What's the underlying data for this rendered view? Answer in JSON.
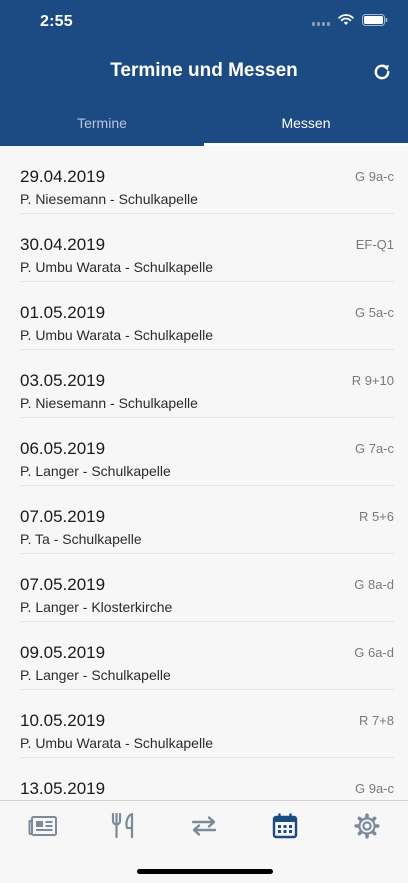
{
  "status_bar": {
    "time": "2:55"
  },
  "header": {
    "title": "Termine und Messen",
    "refresh_icon": "refresh-icon"
  },
  "tabs": [
    {
      "label": "Termine",
      "active": false
    },
    {
      "label": "Messen",
      "active": true
    }
  ],
  "colors": {
    "header": "#1c4a82",
    "active_tab_icon": "#1c4a82",
    "inactive_icon": "#7d8a99"
  },
  "masses": [
    {
      "date": "29.04.2019",
      "class": "G 9a-c",
      "description": "P. Niesemann - Schulkapelle"
    },
    {
      "date": "30.04.2019",
      "class": "EF-Q1",
      "description": "P. Umbu Warata - Schulkapelle"
    },
    {
      "date": "01.05.2019",
      "class": "G 5a-c",
      "description": "P. Umbu Warata - Schulkapelle"
    },
    {
      "date": "03.05.2019",
      "class": "R 9+10",
      "description": "P. Niesemann - Schulkapelle"
    },
    {
      "date": "06.05.2019",
      "class": "G 7a-c",
      "description": "P. Langer - Schulkapelle"
    },
    {
      "date": "07.05.2019",
      "class": "R 5+6",
      "description": "P. Ta - Schulkapelle"
    },
    {
      "date": "07.05.2019",
      "class": "G 8a-d",
      "description": "P. Langer - Klosterkirche"
    },
    {
      "date": "09.05.2019",
      "class": "G 6a-d",
      "description": "P. Langer - Schulkapelle"
    },
    {
      "date": "10.05.2019",
      "class": "R 7+8",
      "description": "P. Umbu Warata - Schulkapelle"
    },
    {
      "date": "13.05.2019",
      "class": "G 9a-c",
      "description": ""
    }
  ],
  "tab_bar": [
    {
      "icon": "news-icon",
      "active": false
    },
    {
      "icon": "food-icon",
      "active": false
    },
    {
      "icon": "swap-icon",
      "active": false
    },
    {
      "icon": "calendar-icon",
      "active": true
    },
    {
      "icon": "settings-icon",
      "active": false
    }
  ]
}
